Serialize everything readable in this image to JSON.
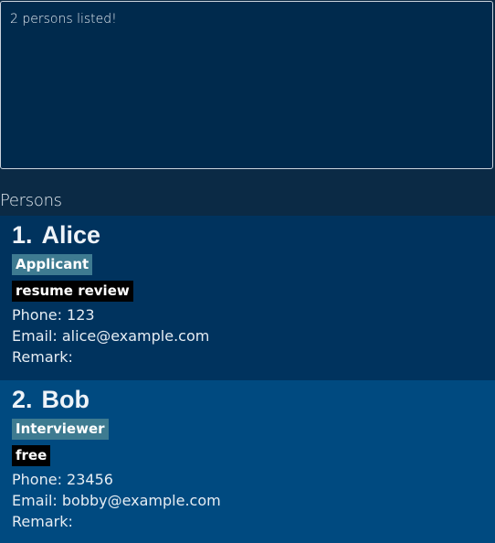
{
  "result_display": {
    "text": "2 persons listed!"
  },
  "person_list": {
    "title": "Persons",
    "persons": [
      {
        "index": "1.",
        "name": "Alice",
        "role": "Applicant",
        "status": "resume review",
        "phone": "Phone: 123",
        "email": "Email: alice@example.com",
        "remark": "Remark:"
      },
      {
        "index": "2.",
        "name": "Bob",
        "role": "Interviewer",
        "status": "free",
        "phone": "Phone: 23456",
        "email": "Email: bobby@example.com",
        "remark": "Remark:"
      }
    ]
  },
  "colors": {
    "background": "#0b2a45",
    "result_background": "#002a4d",
    "card_odd": "#00335e",
    "card_even": "#004a80",
    "role_tag": "#3e7b91",
    "status_tag": "#000000"
  }
}
